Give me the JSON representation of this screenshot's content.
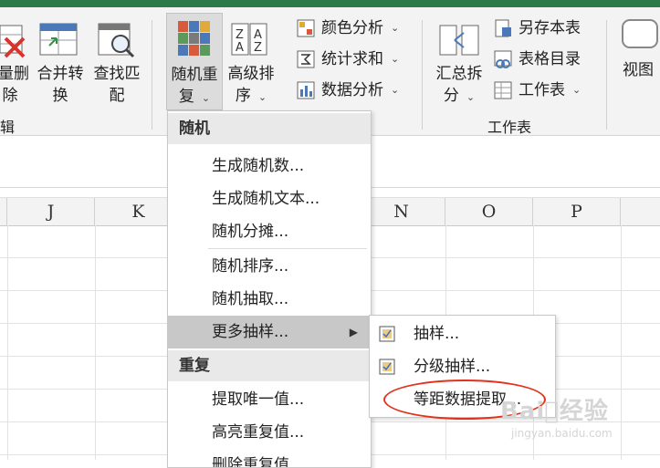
{
  "ribbon": {
    "btn_delete": {
      "line1": "量删",
      "line2": "除"
    },
    "btn_merge": {
      "line1": "合并转",
      "line2": "换"
    },
    "btn_find": {
      "line1": "查找匹",
      "line2": "配"
    },
    "btn_random": {
      "line1": "随机重",
      "line2": "复"
    },
    "btn_sort": {
      "line1": "高级排",
      "line2": "序"
    },
    "small_col1": [
      "颜色分析",
      "统计求和",
      "数据分析"
    ],
    "btn_summary": {
      "line1": "汇总拆",
      "line2": "分"
    },
    "small_col2": [
      "另存本表",
      "表格目录",
      "工作表"
    ],
    "btn_view": {
      "line1": "视图"
    },
    "group_edit": "辑",
    "group_sheet": "工作表",
    "chevron": "⌄"
  },
  "columns": [
    "J",
    "K",
    "N",
    "O",
    "P"
  ],
  "menu": {
    "header_random": "随机",
    "items_random": [
      "生成随机数...",
      "生成随机文本...",
      "随机分摊...",
      "随机排序...",
      "随机抽取...",
      "更多抽样..."
    ],
    "header_repeat": "重复",
    "items_repeat": [
      "提取唯一值...",
      "高亮重复值...",
      "删除重复值..."
    ]
  },
  "submenu": {
    "items": [
      "抽样...",
      "分级抽样...",
      "等距数据提取..."
    ]
  },
  "watermark": {
    "main": "Bai⃝经验",
    "sub": "jingyan.baidu.com"
  },
  "colors": {
    "accent_green": "#2b7a47",
    "annotation_red": "#e2321c",
    "highlight_gray": "#c8c8c8"
  }
}
